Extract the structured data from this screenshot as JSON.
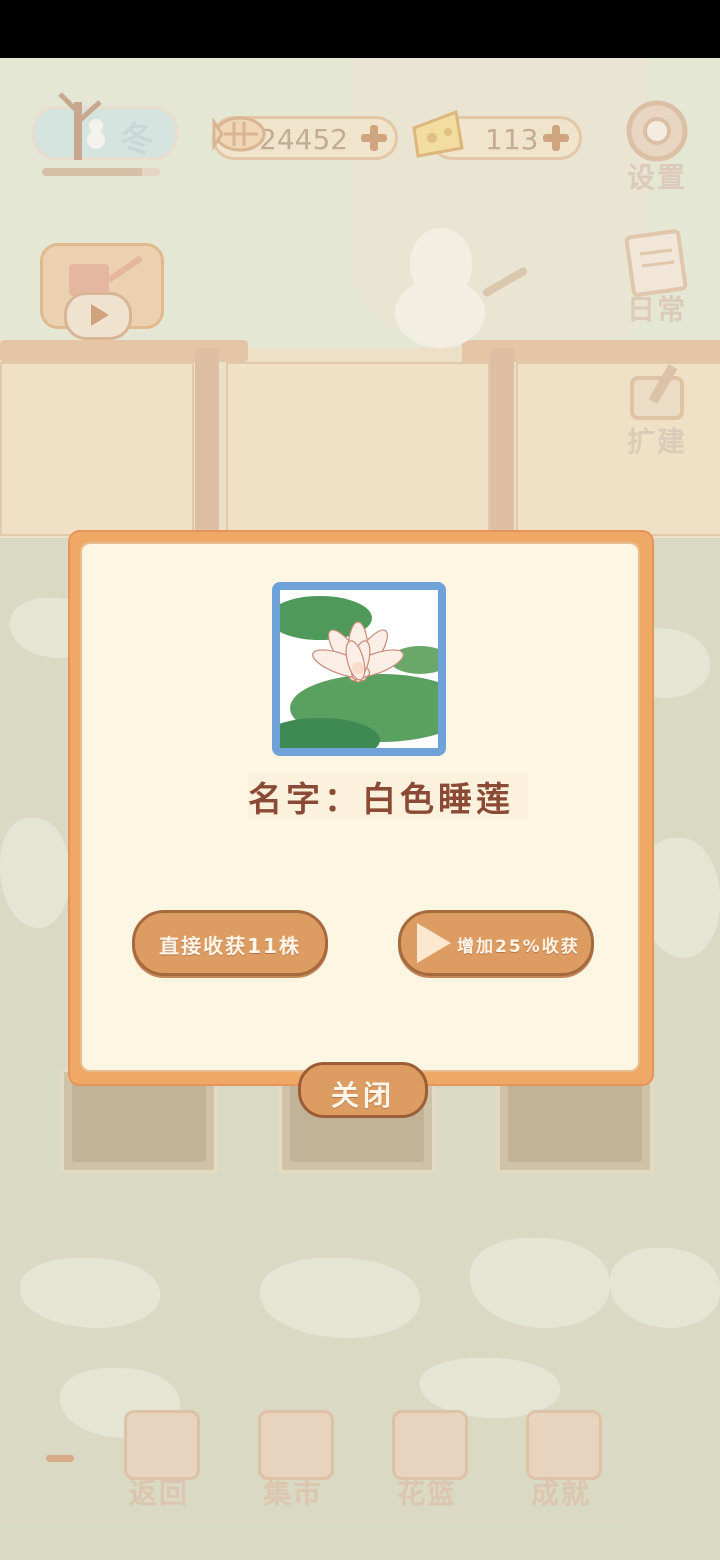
{
  "hud": {
    "season": "冬",
    "season_progress": 0.85,
    "fish_count": "24452",
    "cheese_count": "113",
    "settings_label": "设置",
    "daily_label": "日常",
    "expand_label": "扩建"
  },
  "dialog": {
    "name_prefix": "名字：",
    "plant_name": "白色睡莲",
    "harvest_label": "直接收获11株",
    "bonus_label": "增加25%收获",
    "close_label": "关闭"
  },
  "nav": {
    "back": "返回",
    "market": "集市",
    "basket": "花篮",
    "achievements": "成就"
  },
  "colors": {
    "dialog_border": "#f0a866",
    "dialog_bg": "#fdf6e3",
    "button": "#dd9c62",
    "title_text": "#8b4a35",
    "frame_blue": "#6fa2d8"
  }
}
